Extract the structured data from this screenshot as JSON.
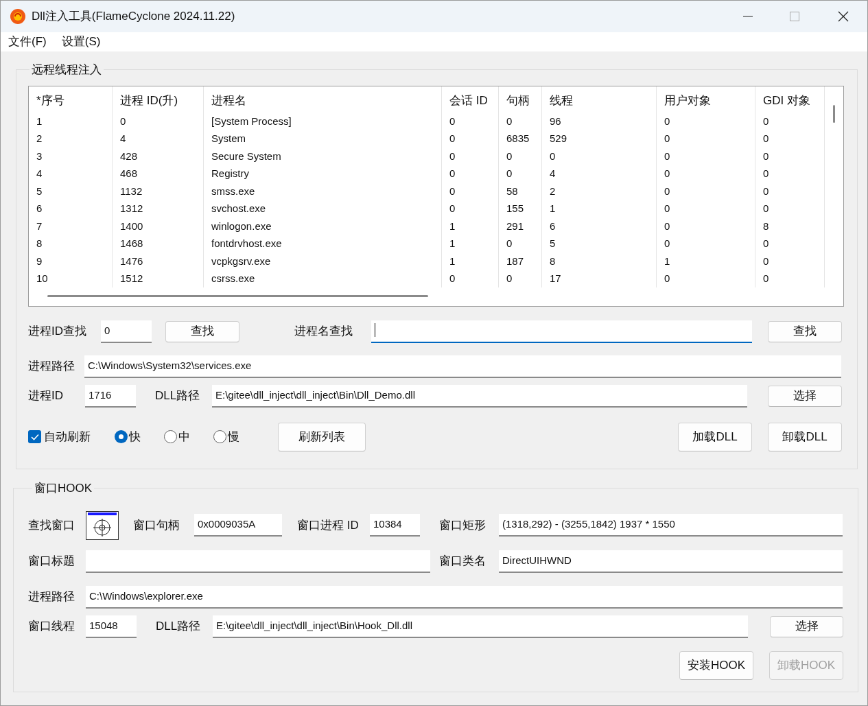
{
  "window": {
    "title": "Dll注入工具(FlameCyclone 2024.11.22)"
  },
  "menu": [
    "文件(F)",
    "设置(S)"
  ],
  "injection": {
    "title": "远程线程注入",
    "table": {
      "columns": [
        "*序号",
        "进程 ID(升)",
        "进程名",
        "会话 ID",
        "句柄",
        "线程",
        "用户对象",
        "GDI 对象"
      ],
      "rows": [
        [
          "1",
          "0",
          "[System Process]",
          "0",
          "0",
          "96",
          "0",
          "0"
        ],
        [
          "2",
          "4",
          "System",
          "0",
          "6835",
          "529",
          "0",
          "0"
        ],
        [
          "3",
          "428",
          "Secure System",
          "0",
          "0",
          "0",
          "0",
          "0"
        ],
        [
          "4",
          "468",
          "Registry",
          "0",
          "0",
          "4",
          "0",
          "0"
        ],
        [
          "5",
          "1132",
          "smss.exe",
          "0",
          "58",
          "2",
          "0",
          "0"
        ],
        [
          "6",
          "1312",
          "svchost.exe",
          "0",
          "155",
          "1",
          "0",
          "0"
        ],
        [
          "7",
          "1400",
          "winlogon.exe",
          "1",
          "291",
          "6",
          "0",
          "8"
        ],
        [
          "8",
          "1468",
          "fontdrvhost.exe",
          "1",
          "0",
          "5",
          "0",
          "0"
        ],
        [
          "9",
          "1476",
          "vcpkgsrv.exe",
          "1",
          "187",
          "8",
          "1",
          "0"
        ],
        [
          "10",
          "1512",
          "csrss.exe",
          "0",
          "0",
          "17",
          "0",
          "0"
        ]
      ]
    },
    "pid_search": {
      "label": "进程ID查找",
      "value": "0",
      "button": "查找"
    },
    "name_search": {
      "label": "进程名查找",
      "focused": true,
      "button": "查找"
    },
    "process_path": {
      "label": "进程路径",
      "value": "C:\\Windows\\System32\\services.exe"
    },
    "pid": {
      "label": "进程ID",
      "value": "1716"
    },
    "dll_path": {
      "label": "DLL路径",
      "value": "E:\\gitee\\dll_inject\\dll_inject\\Bin\\Dll_Demo.dll",
      "button": "选择"
    },
    "auto_refresh": {
      "label": "自动刷新",
      "checked": true
    },
    "speeds": [
      {
        "label": "快",
        "selected": true
      },
      {
        "label": "中",
        "selected": false
      },
      {
        "label": "慢",
        "selected": false
      }
    ],
    "refresh_button": "刷新列表",
    "actions": [
      {
        "label": "加载DLL",
        "disabled": false
      },
      {
        "label": "卸载DLL",
        "disabled": false
      }
    ]
  },
  "hook": {
    "title": "窗口HOOK",
    "find_window": {
      "label": "查找窗口"
    },
    "handle": {
      "label": "窗口句柄",
      "value": "0x0009035A"
    },
    "window_pid": {
      "label": "窗口进程 ID",
      "value": "10384"
    },
    "rect": {
      "label": "窗口矩形",
      "value": "(1318,292) - (3255,1842) 1937 * 1550"
    },
    "window_title": {
      "label": "窗口标题"
    },
    "class_name": {
      "label": "窗口类名",
      "value": "DirectUIHWND"
    },
    "process_path": {
      "label": "进程路径",
      "value": "C:\\Windows\\explorer.exe"
    },
    "thread": {
      "label": "窗口线程",
      "value": "15048"
    },
    "dll_path": {
      "label": "DLL路径",
      "value": "E:\\gitee\\dll_inject\\dll_inject\\Bin\\Hook_Dll.dll",
      "button": "选择"
    },
    "actions": [
      {
        "label": "安装HOOK",
        "disabled": false
      },
      {
        "label": "卸载HOOK",
        "disabled": true
      }
    ]
  }
}
